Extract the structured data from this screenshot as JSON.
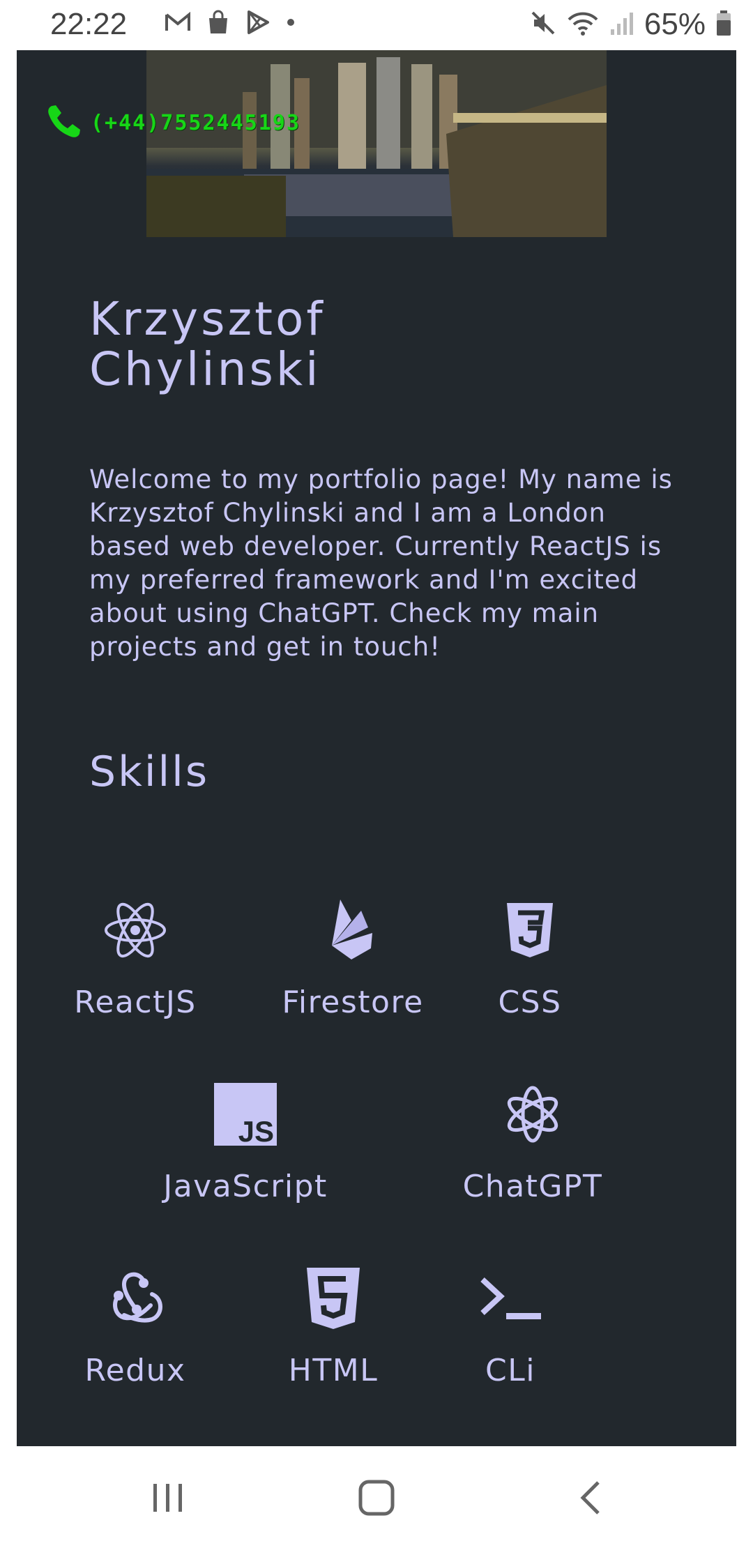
{
  "status_bar": {
    "time": "22:22",
    "battery": "65%",
    "left_icons": [
      "gmail-icon",
      "shopping-bag-icon",
      "play-store-icon",
      "dot-icon"
    ],
    "right_icons": [
      "mute-icon",
      "wifi-icon",
      "signal-icon",
      "battery-icon"
    ]
  },
  "header": {
    "phone": "(+44)7552445193",
    "phone_color": "#17d617"
  },
  "profile": {
    "name_line1": "Krzysztof",
    "name_line2": "Chylinski",
    "intro": "Welcome to my portfolio page! My name is Krzysztof Chylinski and I am a London based web developer. Currently ReactJS is my preferred framework and I'm excited about using ChatGPT. Check my main projects and get in touch!"
  },
  "skills": {
    "title": "Skills",
    "items": [
      {
        "label": "ReactJS",
        "icon": "react-icon"
      },
      {
        "label": "Firestore",
        "icon": "firestore-icon"
      },
      {
        "label": "CSS",
        "icon": "css3-icon"
      },
      {
        "label": "JavaScript",
        "icon": "javascript-icon"
      },
      {
        "label": "ChatGPT",
        "icon": "chatgpt-icon"
      },
      {
        "label": "Redux",
        "icon": "redux-icon"
      },
      {
        "label": "HTML",
        "icon": "html5-icon"
      },
      {
        "label": "CLi",
        "icon": "terminal-icon"
      }
    ]
  },
  "colors": {
    "panel_bg": "#22282d",
    "accent_text": "#c8c6f5"
  },
  "nav_bar": {
    "buttons": [
      "recent-apps-icon",
      "home-icon",
      "back-icon"
    ]
  }
}
